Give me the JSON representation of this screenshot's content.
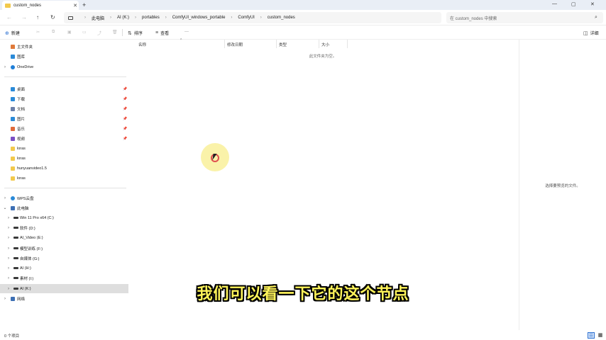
{
  "window": {
    "tab_title": "custom_nodes",
    "tab_close": "✕",
    "new_tab": "+",
    "minimize": "—",
    "maximize": "▢",
    "close": "✕"
  },
  "address_bar": {
    "breadcrumbs": [
      "此电脑",
      "AI (K:)",
      "portables",
      "ComfyUI_windows_portable",
      "ComfyUI",
      "custom_nodes"
    ],
    "search_placeholder": "在 custom_nodes 中搜索"
  },
  "command_bar": {
    "new_label": "新建",
    "sort_label": "排序",
    "view_label": "查看",
    "more_label": "···",
    "details_label": "详细"
  },
  "nav_pane": {
    "home": "主文件夹",
    "gallery": "图库",
    "onedrive": "OneDrive",
    "quick_access": [
      {
        "label": "桌面",
        "icon": "desktop-icon",
        "color": "#2a8ad8"
      },
      {
        "label": "下载",
        "icon": "download-icon",
        "color": "#2a8ad8"
      },
      {
        "label": "文档",
        "icon": "document-icon",
        "color": "#6b7fa8"
      },
      {
        "label": "图片",
        "icon": "pictures-icon",
        "color": "#2a8ad8"
      },
      {
        "label": "音乐",
        "icon": "music-icon",
        "color": "#e06a3a"
      },
      {
        "label": "视频",
        "icon": "video-icon",
        "color": "#7b4fc4"
      },
      {
        "label": "loras",
        "icon": "folder-icon",
        "color": "#f2c94c"
      },
      {
        "label": "loras",
        "icon": "folder-icon",
        "color": "#f2c94c"
      },
      {
        "label": "hunyuanvideo1.5",
        "icon": "folder-icon",
        "color": "#f2c94c"
      },
      {
        "label": "loras",
        "icon": "folder-icon",
        "color": "#f2c94c"
      }
    ],
    "wps_cloud": "WPS云盘",
    "this_pc": "此电脑",
    "drives": [
      {
        "label": "Win 11 Pro x64 (C:)"
      },
      {
        "label": "软件 (D:)"
      },
      {
        "label": "AI_Video (E:)"
      },
      {
        "label": "模型训练 (F:)"
      },
      {
        "label": "自媒体 (G:)"
      },
      {
        "label": "AI (H:)"
      },
      {
        "label": "素材 (I:)"
      },
      {
        "label": "AI (K:)"
      }
    ],
    "network": "网络"
  },
  "file_list": {
    "columns": [
      "名称",
      "修改日期",
      "类型",
      "大小"
    ],
    "empty_message": "此文件夹为空。"
  },
  "preview_pane": {
    "message": "选择要预览的文件。"
  },
  "status_bar": {
    "item_count": "0 个项目"
  },
  "subtitle": "我们可以看一下它的这个节点"
}
